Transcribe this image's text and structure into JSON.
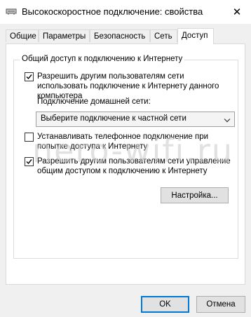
{
  "window": {
    "title": "Высокоскоростное подключение: свойства",
    "close_glyph": "✕",
    "icon": "network-connection-icon"
  },
  "tabs": [
    {
      "label": "Общие"
    },
    {
      "label": "Параметры"
    },
    {
      "label": "Безопасность"
    },
    {
      "label": "Сеть"
    },
    {
      "label": "Доступ"
    }
  ],
  "active_tab": "Доступ",
  "group": {
    "title": "Общий доступ к подключению к Интернету"
  },
  "option_share": {
    "checked": true,
    "label_line1": "Разрешить другим пользователям сети",
    "label_line2": "использовать подключение к Интернету данного",
    "label_line3": "компьютера"
  },
  "home_network": {
    "label": "Подключение домашней сети:",
    "selected": "Выберите подключение к частной сети"
  },
  "option_dial": {
    "checked": false,
    "label_line1": "Устанавливать телефонное подключение при",
    "label_line2": "попытке доступа к Интернету"
  },
  "option_control": {
    "checked": true,
    "label_line1": "Разрешить другим пользователям сети управление",
    "label_line2": "общим доступом к подключению к Интернету"
  },
  "settings_button": "Настройка...",
  "ok_button": "OK",
  "cancel_button": "Отмена",
  "watermark": "nero-wifi.ru",
  "colors": {
    "accent": "#0078d7",
    "window_bg": "#f0f0f0",
    "panel_bg": "#ffffff"
  }
}
